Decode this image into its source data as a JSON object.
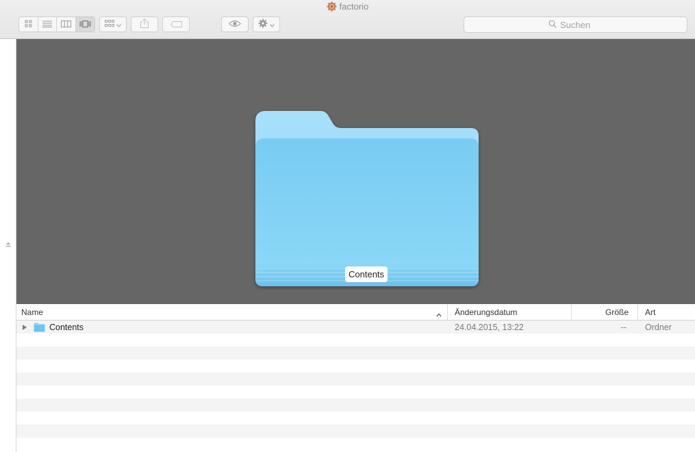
{
  "window": {
    "title": "factorio",
    "app_icon": "gear-app-icon"
  },
  "toolbar": {
    "view_modes": [
      {
        "name": "icon-view",
        "icon": "grid-icon",
        "active": false
      },
      {
        "name": "list-view",
        "icon": "list-icon",
        "active": false
      },
      {
        "name": "column-view",
        "icon": "columns-icon",
        "active": false
      },
      {
        "name": "coverflow-view",
        "icon": "coverflow-icon",
        "active": true
      }
    ],
    "arrange_icon": "arrange-icon",
    "share_icon": "share-icon",
    "tag_icon": "tag-icon",
    "quicklook_icon": "eye-icon",
    "action_icon": "gear-icon"
  },
  "search": {
    "placeholder": "Suchen"
  },
  "preview": {
    "label": "Contents"
  },
  "list": {
    "columns": {
      "name": "Name",
      "modified": "Änderungsdatum",
      "size": "Größe",
      "kind": "Art"
    },
    "rows": [
      {
        "name": "Contents",
        "modified": "24.04.2015, 13:22",
        "size": "--",
        "kind": "Ordner"
      }
    ]
  },
  "colors": {
    "preview_background": "#666666",
    "folder_blue": "#7fcdf4",
    "stripe": "#f4f4f4"
  }
}
